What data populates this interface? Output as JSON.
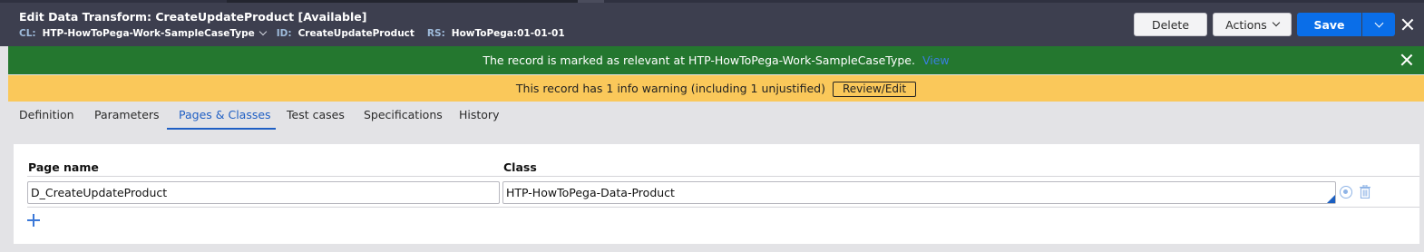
{
  "header": {
    "title_prefix": "Edit  Data Transform: CreateUpdateProduct",
    "status": "[Available]",
    "cl_label": "CL:",
    "cl_value": "HTP-HowToPega-Work-SampleCaseType",
    "id_label": "ID:",
    "id_value": "CreateUpdateProduct",
    "rs_label": "RS:",
    "rs_value": "HowToPega:01-01-01"
  },
  "toolbar": {
    "delete_label": "Delete",
    "actions_label": "Actions",
    "save_label": "Save"
  },
  "relevant_banner": {
    "message": "The record is marked as relevant at HTP-HowToPega-Work-SampleCaseType.",
    "link": "View"
  },
  "warning_banner": {
    "message": "This record has 1 info warning (including 1 unjustified)",
    "button": "Review/Edit"
  },
  "tabs": [
    {
      "label": "Definition"
    },
    {
      "label": "Parameters"
    },
    {
      "label": "Pages & Classes"
    },
    {
      "label": "Test cases"
    },
    {
      "label": "Specifications"
    },
    {
      "label": "History"
    }
  ],
  "active_tab": "Pages & Classes",
  "table": {
    "columns": [
      "Page name",
      "Class"
    ],
    "rows": [
      {
        "page_name": "D_CreateUpdateProduct",
        "class": "HTP-HowToPega-Data-Product"
      }
    ]
  },
  "colors": {
    "header_bg": "#3d3f4f",
    "success_bg": "#24772f",
    "warning_bg": "#fac85a",
    "primary": "#0a6ee8",
    "active_tab": "#1f5fc4"
  },
  "icons": [
    "chevron-down-icon",
    "close-icon",
    "target-icon",
    "trash-icon",
    "plus-icon"
  ]
}
